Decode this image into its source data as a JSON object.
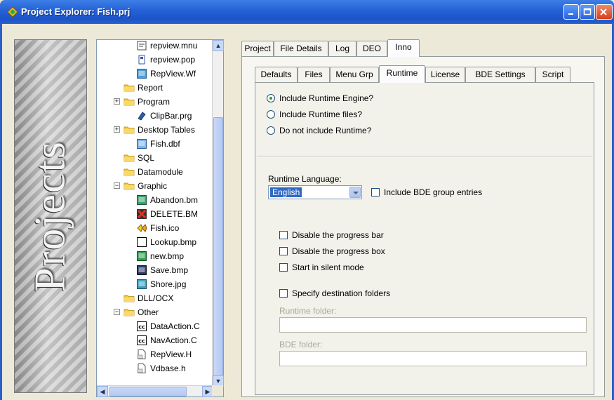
{
  "window": {
    "title": "Project Explorer: Fish.prj",
    "banner_text": "Projects"
  },
  "tree": {
    "items": [
      {
        "label": "repview.mnu",
        "icon": "menu-file-icon",
        "level": 3
      },
      {
        "label": "repview.pop",
        "icon": "popup-file-icon",
        "level": 3
      },
      {
        "label": "RepView.Wf",
        "icon": "form-file-icon",
        "level": 3
      },
      {
        "label": "Report",
        "icon": "folder-icon",
        "level": 2
      },
      {
        "label": "Program",
        "icon": "folder-icon",
        "level": 2,
        "expander": "+"
      },
      {
        "label": "ClipBar.prg",
        "icon": "program-file-icon",
        "level": 3
      },
      {
        "label": "Desktop Tables",
        "icon": "folder-icon",
        "level": 2,
        "expander": "+"
      },
      {
        "label": "Fish.dbf",
        "icon": "table-file-icon",
        "level": 3
      },
      {
        "label": "SQL",
        "icon": "folder-icon",
        "level": 2
      },
      {
        "label": "Datamodule",
        "icon": "folder-icon",
        "level": 2
      },
      {
        "label": "Graphic",
        "icon": "folder-icon",
        "level": 2,
        "expander": "-"
      },
      {
        "label": "Abandon.bm",
        "icon": "bitmap-icon",
        "level": 3
      },
      {
        "label": "DELETE.BM",
        "icon": "delete-bitmap-icon",
        "level": 3
      },
      {
        "label": "Fish.ico",
        "icon": "fish-icon",
        "level": 3
      },
      {
        "label": "Lookup.bmp",
        "icon": "lookup-bitmap-icon",
        "level": 3
      },
      {
        "label": "new.bmp",
        "icon": "new-bitmap-icon",
        "level": 3
      },
      {
        "label": "Save.bmp",
        "icon": "save-bitmap-icon",
        "level": 3
      },
      {
        "label": "Shore.jpg",
        "icon": "image-file-icon",
        "level": 3
      },
      {
        "label": "DLL/OCX",
        "icon": "folder-icon",
        "level": 2
      },
      {
        "label": "Other",
        "icon": "folder-icon",
        "level": 2,
        "expander": "-"
      },
      {
        "label": "DataAction.C",
        "icon": "cc-file-icon",
        "level": 3
      },
      {
        "label": "NavAction.C",
        "icon": "cc-file-icon",
        "level": 3
      },
      {
        "label": "RepView.H",
        "icon": "header-file-icon",
        "level": 3
      },
      {
        "label": "Vdbase.h",
        "icon": "header-file-icon",
        "level": 3
      }
    ]
  },
  "outer_tabs": [
    "Project",
    "File Details",
    "Log",
    "DEO",
    "Inno"
  ],
  "outer_active": "Inno",
  "inner_tabs": [
    "Defaults",
    "Files",
    "Menu Grp",
    "Runtime",
    "License",
    "BDE Settings",
    "Script"
  ],
  "inner_active": "Runtime",
  "runtime": {
    "radio_options": [
      {
        "label": "Include Runtime Engine?",
        "selected": true
      },
      {
        "label": "Include Runtime files?",
        "selected": false
      },
      {
        "label": "Do not include Runtime?",
        "selected": false
      }
    ],
    "language_label": "Runtime Language:",
    "language_value": "English",
    "bde_group_label": "Include BDE group entries",
    "progress_bar_label": "Disable the progress bar",
    "progress_box_label": "Disable the progress box",
    "silent_label": "Start in silent mode",
    "dest_folders_label": "Specify destination folders",
    "runtime_folder_label": "Runtime folder:",
    "bde_folder_label": "BDE folder:"
  },
  "colors": {
    "titlebar": "#2763d6",
    "selection": "#316ac5"
  }
}
